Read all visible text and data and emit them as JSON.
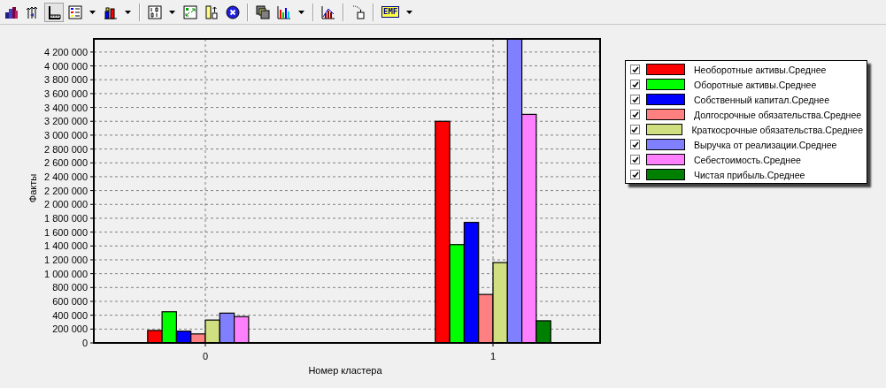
{
  "toolbar": {
    "groups": [
      [
        {
          "pressed": false,
          "dropdown": false
        },
        {
          "pressed": false,
          "dropdown": false
        },
        {
          "pressed": true,
          "dropdown": false
        },
        {
          "pressed": false,
          "dropdown": true
        },
        {
          "pressed": false,
          "dropdown": true
        }
      ],
      [
        {
          "pressed": false,
          "dropdown": true
        },
        {
          "pressed": false,
          "dropdown": false
        },
        {
          "pressed": false,
          "dropdown": false
        },
        {
          "pressed": false,
          "dropdown": false
        }
      ],
      [
        {
          "pressed": false,
          "dropdown": false
        },
        {
          "pressed": false,
          "dropdown": true
        }
      ],
      [
        {
          "pressed": false,
          "dropdown": false
        }
      ],
      [
        {
          "pressed": false,
          "dropdown": false
        }
      ],
      [
        {
          "label": "EMF",
          "pressed": false,
          "dropdown": true
        }
      ]
    ]
  },
  "chart": {
    "chart_data": {
      "type": "bar",
      "grid": true,
      "xlabel": "Номер кластера",
      "ylabel": "Факты",
      "categories": [
        "0",
        "1"
      ],
      "series": [
        {
          "name": "Необоротные активы.Среднее",
          "color": "#ff0000",
          "values": [
            180000,
            3200000
          ]
        },
        {
          "name": "Оборотные активы.Среднее",
          "color": "#00ff00",
          "values": [
            450000,
            1420000
          ]
        },
        {
          "name": "Собственный капитал.Среднее",
          "color": "#0000ff",
          "values": [
            170000,
            1740000
          ]
        },
        {
          "name": "Долгосрочные обязательства.Среднее",
          "color": "#ff8080",
          "values": [
            130000,
            700000
          ]
        },
        {
          "name": "Краткосрочные обязательства.Среднее",
          "color": "#d0e080",
          "values": [
            330000,
            1160000
          ]
        },
        {
          "name": "Выручка от реализации.Среднее",
          "color": "#8080ff",
          "values": [
            430000,
            4390000
          ]
        },
        {
          "name": "Себестоимость.Среднее",
          "color": "#ff80ff",
          "values": [
            380000,
            3300000
          ]
        },
        {
          "name": "Чистая прибыль.Среднее",
          "color": "#008000",
          "values": [
            0,
            320000
          ]
        }
      ],
      "ylim": [
        0,
        4390000
      ],
      "yticks": [
        {
          "value": 0,
          "label": "0"
        },
        {
          "value": 200000,
          "label": "200 000"
        },
        {
          "value": 400000,
          "label": "400 000"
        },
        {
          "value": 600000,
          "label": "600 000"
        },
        {
          "value": 800000,
          "label": "800 000"
        },
        {
          "value": 1000000,
          "label": "1 000 000"
        },
        {
          "value": 1200000,
          "label": "1 200 000"
        },
        {
          "value": 1400000,
          "label": "1 400 000"
        },
        {
          "value": 1600000,
          "label": "1 600 000"
        },
        {
          "value": 1800000,
          "label": "1 800 000"
        },
        {
          "value": 2000000,
          "label": "2 000 000"
        },
        {
          "value": 2200000,
          "label": "2 200 000"
        },
        {
          "value": 2400000,
          "label": "2 400 000"
        },
        {
          "value": 2600000,
          "label": "2 600 000"
        },
        {
          "value": 2800000,
          "label": "2 800 000"
        },
        {
          "value": 3000000,
          "label": "3 000 000"
        },
        {
          "value": 3200000,
          "label": "3 200 000"
        },
        {
          "value": 3400000,
          "label": "3 400 000"
        },
        {
          "value": 3600000,
          "label": "3 600 000"
        },
        {
          "value": 3800000,
          "label": "3 800 000"
        },
        {
          "value": 4000000,
          "label": "4 000 000"
        },
        {
          "value": 4200000,
          "label": "4 200 000"
        }
      ]
    },
    "legend": {
      "items": [
        {
          "checked": true
        },
        {
          "checked": true
        },
        {
          "checked": true
        },
        {
          "checked": true
        },
        {
          "checked": true
        },
        {
          "checked": true
        },
        {
          "checked": true
        },
        {
          "checked": true
        }
      ]
    }
  }
}
